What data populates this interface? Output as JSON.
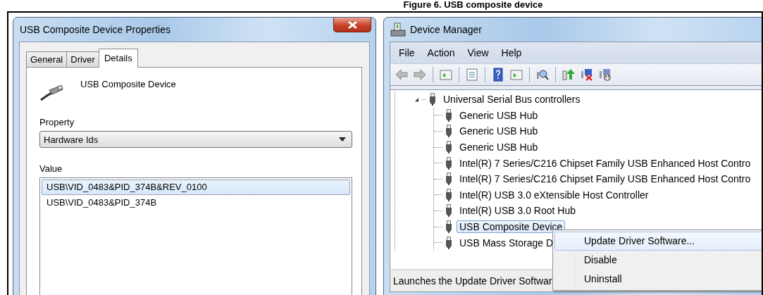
{
  "caption": "Figure 6. USB composite device",
  "properties_window": {
    "title": "USB Composite Device Properties",
    "tabs": [
      {
        "label": "General",
        "selected": false
      },
      {
        "label": "Driver",
        "selected": false
      },
      {
        "label": "Details",
        "selected": true
      }
    ],
    "device_name": "USB Composite Device",
    "property_label": "Property",
    "property_select": {
      "value": "Hardware Ids"
    },
    "value_label": "Value",
    "values": [
      {
        "text": "USB\\VID_0483&PID_374B&REV_0100",
        "selected": true
      },
      {
        "text": "USB\\VID_0483&PID_374B",
        "selected": false
      }
    ]
  },
  "device_manager": {
    "title": "Device Manager",
    "menu": [
      {
        "label": "File"
      },
      {
        "label": "Action"
      },
      {
        "label": "View"
      },
      {
        "label": "Help"
      }
    ],
    "tree": [
      {
        "label": "Universal Serial Bus controllers",
        "expanded": true,
        "selected": false,
        "children": [
          {
            "label": "Generic USB Hub",
            "selected": false
          },
          {
            "label": "Generic USB Hub",
            "selected": false
          },
          {
            "label": "Generic USB Hub",
            "selected": false
          },
          {
            "label": "Intel(R) 7 Series/C216 Chipset Family USB Enhanced Host Contro",
            "selected": false
          },
          {
            "label": "Intel(R) 7 Series/C216 Chipset Family USB Enhanced Host Contro",
            "selected": false
          },
          {
            "label": "Intel(R) USB 3.0 eXtensible Host Controller",
            "selected": false
          },
          {
            "label": "Intel(R) USB 3.0 Root Hub",
            "selected": false
          },
          {
            "label": "USB Composite Device",
            "selected": true
          },
          {
            "label": "USB Mass Storage D",
            "selected": false
          }
        ]
      }
    ],
    "status_bar": "Launches the Update Driver Softwar",
    "context_menu": [
      {
        "label": "Update Driver Software...",
        "selected": true
      },
      {
        "label": "Disable",
        "selected": false
      },
      {
        "label": "Uninstall",
        "selected": false
      }
    ]
  }
}
